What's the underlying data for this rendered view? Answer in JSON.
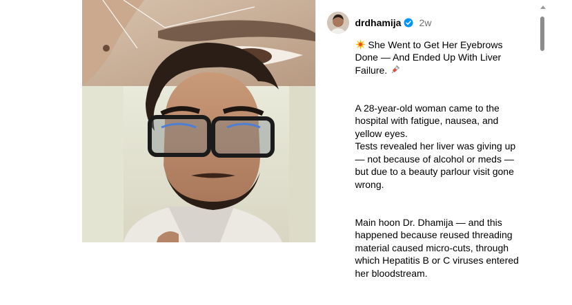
{
  "post": {
    "username": "drdhamija",
    "time_ago": "2w",
    "caption": {
      "title_line1": "She Went to Get Her Eyebrows Done — And Ended Up With Liver Failure.",
      "para1": "A 28-year-old woman came to the hospital with fatigue, nausea, and yellow eyes.\nTests revealed her liver was giving up — not because of alcohol or meds — but due to a beauty parlour visit gone wrong.",
      "para2": "Main hoon Dr. Dhamija — and this happened because reused threading material caused micro-cuts, through which Hepatitis B or C viruses entered her bloodstream."
    }
  },
  "icons": {
    "verified": "verified-badge-icon",
    "spark": "collision-emoji-icon",
    "syringe": "syringe-emoji-icon"
  },
  "colors": {
    "verified_blue": "#0095f6",
    "muted_text": "#737373"
  }
}
